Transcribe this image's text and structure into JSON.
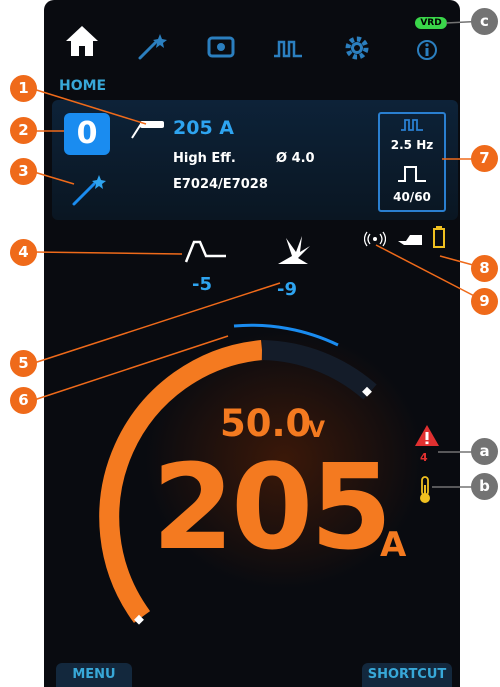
{
  "nav": {
    "items": [
      {
        "name": "home",
        "icon": "home-icon"
      },
      {
        "name": "wizard",
        "icon": "magic-wand-icon"
      },
      {
        "name": "memory",
        "icon": "memory-card-icon"
      },
      {
        "name": "pulse",
        "icon": "pulse-wave-icon"
      },
      {
        "name": "settings",
        "icon": "gear-icon"
      },
      {
        "name": "info",
        "icon": "info-icon"
      }
    ],
    "vrd_label": "VRD",
    "page_label": "HOME"
  },
  "job": {
    "number": "0",
    "current": "205 A",
    "efficiency": "High Eff.",
    "diameter": "Ø 4.0",
    "electrode": "E7024/E7028"
  },
  "pulse": {
    "frequency": "2.5 Hz",
    "duty": "40/60"
  },
  "params": {
    "hot_start": "-5",
    "arc_force": "-9"
  },
  "display": {
    "voltage": "50.0",
    "voltage_unit": "V",
    "current": "205",
    "current_unit": "A",
    "level_fraction": 0.62,
    "alarm_count": "4"
  },
  "buttons": {
    "menu": "MENU",
    "shortcut": "SHORTCUT"
  },
  "callouts": {
    "c1": "1",
    "c2": "2",
    "c3": "3",
    "c4": "4",
    "c5": "5",
    "c6": "6",
    "c7": "7",
    "c8": "8",
    "c9": "9",
    "ca": "a",
    "cb": "b",
    "cc": "c"
  },
  "colors": {
    "accent_blue": "#2ea4f0",
    "accent_orange": "#f47a20",
    "callout_orange": "#ef6a1a",
    "callout_gray": "#737373",
    "vrd_green": "#3ad64a",
    "alarm_red": "#e03030",
    "temp_yellow": "#f0c020"
  }
}
